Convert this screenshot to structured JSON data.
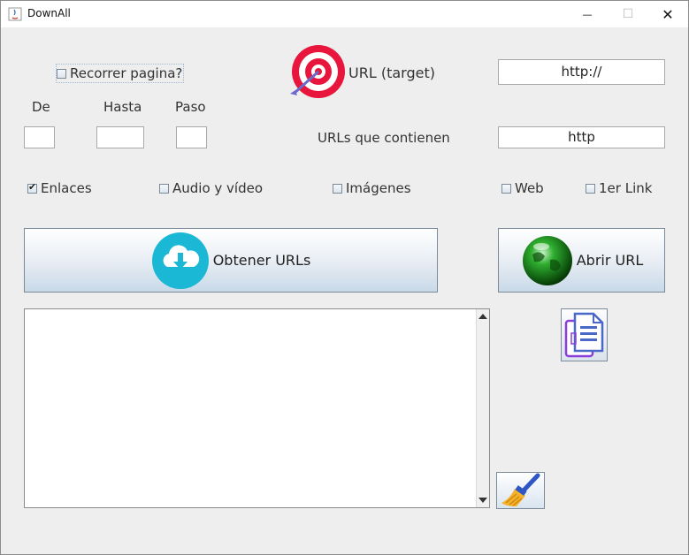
{
  "window": {
    "title": "DownAll",
    "minimize_glyph": "—",
    "maximize_glyph": "☐",
    "close_glyph": "✕"
  },
  "options": {
    "recorrer_label": "Recorrer pagina?",
    "recorrer_checked": false
  },
  "range": {
    "de_label": "De",
    "hasta_label": "Hasta",
    "paso_label": "Paso",
    "de_value": "",
    "hasta_value": "",
    "paso_value": ""
  },
  "target": {
    "url_label": "URL (target)",
    "url_value": "http://",
    "contains_label": "URLs que contienen",
    "contains_value": "http"
  },
  "filters": [
    {
      "label": "Enlaces",
      "checked": true
    },
    {
      "label": "Audio y vídeo",
      "checked": false
    },
    {
      "label": "Imágenes",
      "checked": false
    },
    {
      "label": "Web",
      "checked": false
    },
    {
      "label": "1er Link",
      "checked": false
    }
  ],
  "buttons": {
    "obtener_label": "Obtener URLs",
    "abrir_label": "Abrir URL"
  },
  "output": {
    "text": ""
  },
  "icons": {
    "target": "target-icon",
    "download": "cloud-download-icon",
    "globe": "globe-icon",
    "copy": "copy-icon",
    "clear": "broom-icon",
    "app": "java-app-icon"
  },
  "colors": {
    "target_red": "#e8163c",
    "download_teal": "#1bb8d6",
    "globe_green": "#1c8a1c",
    "copy_purple": "#8a3fd8"
  }
}
